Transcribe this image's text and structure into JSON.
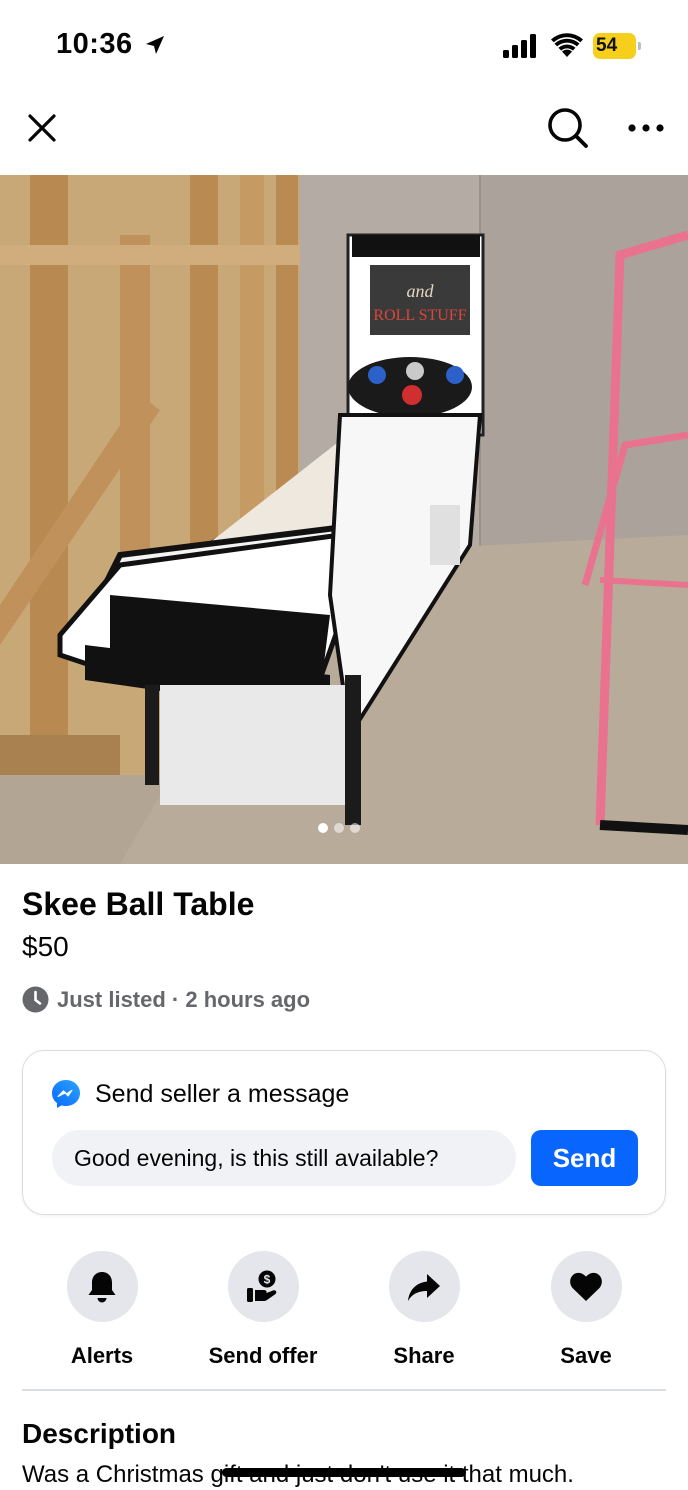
{
  "status_bar": {
    "time": "10:36",
    "battery": "54",
    "icons": [
      "location-arrow-icon",
      "cellular-signal-icon",
      "wifi-icon",
      "battery-charging-icon"
    ]
  },
  "nav": {
    "icons": [
      "close-icon",
      "search-icon",
      "more-icon"
    ]
  },
  "gallery": {
    "photo_count": 3,
    "active_index": 0
  },
  "listing": {
    "title": "Skee Ball Table",
    "price": "$50",
    "listed": "Just listed · 2 hours ago"
  },
  "message": {
    "heading": "Send seller a message",
    "input_value": "Good evening, is this still available?",
    "send_label": "Send"
  },
  "actions": [
    {
      "label": "Alerts",
      "icon": "bell-icon"
    },
    {
      "label": "Send offer",
      "icon": "offer-icon"
    },
    {
      "label": "Share",
      "icon": "share-icon"
    },
    {
      "label": "Save",
      "icon": "heart-icon"
    }
  ],
  "description": {
    "heading": "Description",
    "text": "Was a Christmas gift and just don't use it that much."
  },
  "colors": {
    "primary_blue": "#0866ff",
    "battery_yellow": "#f5cf1c",
    "secondary_text": "#65676b",
    "action_circle": "#e4e6eb"
  }
}
